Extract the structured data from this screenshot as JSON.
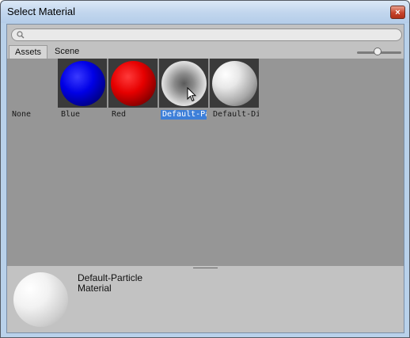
{
  "window": {
    "title": "Select Material",
    "close_glyph": "×"
  },
  "search": {
    "value": "",
    "icon": "search-icon"
  },
  "tabs": [
    {
      "label": "Assets",
      "active": true
    },
    {
      "label": "Scene",
      "active": false
    }
  ],
  "size_slider": {
    "value": 0.45
  },
  "items": [
    {
      "label": "None",
      "kind": "none"
    },
    {
      "label": "Blue",
      "color": "#0000ff"
    },
    {
      "label": "Red",
      "color": "#ff0000"
    },
    {
      "label": "Default-Par",
      "color": "#c8c8c8",
      "selected": true
    },
    {
      "label": "Default-Dif",
      "color": "#e0e0e0"
    }
  ],
  "preview": {
    "line1": "Default-Particle",
    "line2": "Material"
  },
  "colors": {
    "selection": "#3d7fd9",
    "grid_bg": "#969696",
    "panel_bg": "#c2c2c2"
  }
}
